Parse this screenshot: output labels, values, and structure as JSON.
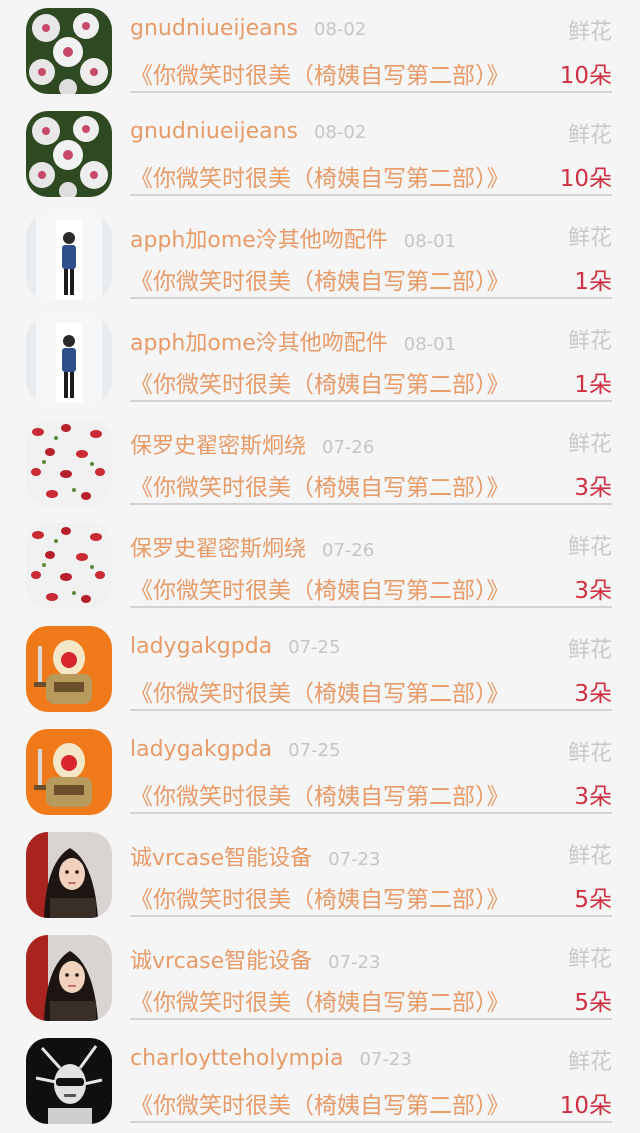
{
  "records": [
    {
      "avatar_icon": "flower-avatar-icon",
      "username": "gnudniueijeans",
      "date": "08-02",
      "type": "鲜花",
      "title": "《你微笑时很美（椅姨自写第二部）》",
      "amount": "10朵"
    },
    {
      "avatar_icon": "flower-avatar-icon",
      "username": "gnudniueijeans",
      "date": "08-02",
      "type": "鲜花",
      "title": "《你微笑时很美（椅姨自写第二部）》",
      "amount": "10朵"
    },
    {
      "avatar_icon": "standing-person-avatar-icon",
      "username": "apph加ome泠其他吻配件",
      "date": "08-01",
      "type": "鲜花",
      "title": "《你微笑时很美（椅姨自写第二部）》",
      "amount": "1朵"
    },
    {
      "avatar_icon": "standing-person-avatar-icon",
      "username": "apph加ome泠其他吻配件",
      "date": "08-01",
      "type": "鲜花",
      "title": "《你微笑时很美（椅姨自写第二部）》",
      "amount": "1朵"
    },
    {
      "avatar_icon": "berries-avatar-icon",
      "username": "保罗史翟密斯炯绕",
      "date": "07-26",
      "type": "鲜花",
      "title": "《你微笑时很美（椅姨自写第二部）》",
      "amount": "3朵"
    },
    {
      "avatar_icon": "berries-avatar-icon",
      "username": "保罗史翟密斯炯绕",
      "date": "07-26",
      "type": "鲜花",
      "title": "《你微笑时很美（椅姨自写第二部）》",
      "amount": "3朵"
    },
    {
      "avatar_icon": "warrior-avatar-icon",
      "username": "ladygakgpda",
      "date": "07-25",
      "type": "鲜花",
      "title": "《你微笑时很美（椅姨自写第二部）》",
      "amount": "3朵"
    },
    {
      "avatar_icon": "warrior-avatar-icon",
      "username": "ladygakgpda",
      "date": "07-25",
      "type": "鲜花",
      "title": "《你微笑时很美（椅姨自写第二部）》",
      "amount": "3朵"
    },
    {
      "avatar_icon": "woman-portrait-avatar-icon",
      "username": "诚vrcase智能设备",
      "date": "07-23",
      "type": "鲜花",
      "title": "《你微笑时很美（椅姨自写第二部）》",
      "amount": "5朵"
    },
    {
      "avatar_icon": "woman-portrait-avatar-icon",
      "username": "诚vrcase智能设备",
      "date": "07-23",
      "type": "鲜花",
      "title": "《你微笑时很美（椅姨自写第二部）》",
      "amount": "5朵"
    },
    {
      "avatar_icon": "man-sunglasses-avatar-icon",
      "username": "charloytteholympia",
      "date": "07-23",
      "type": "鲜花",
      "title": "《你微笑时很美（椅姨自写第二部）》",
      "amount": "10朵"
    }
  ]
}
